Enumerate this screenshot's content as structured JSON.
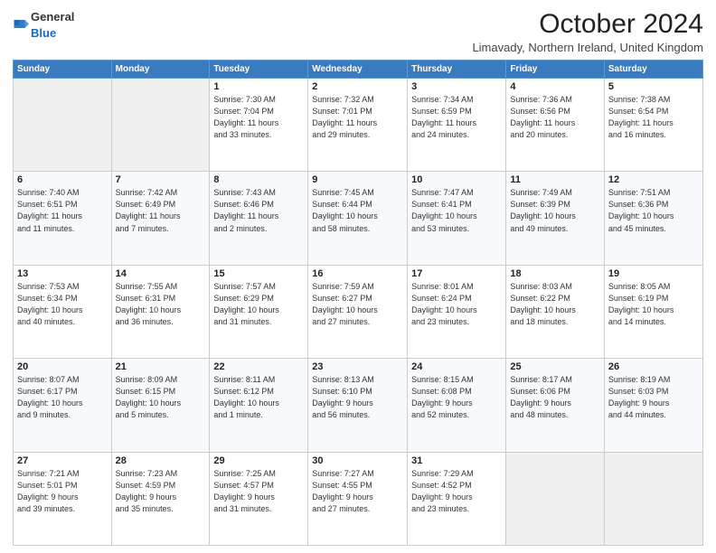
{
  "logo": {
    "general": "General",
    "blue": "Blue"
  },
  "header": {
    "month": "October 2024",
    "location": "Limavady, Northern Ireland, United Kingdom"
  },
  "weekdays": [
    "Sunday",
    "Monday",
    "Tuesday",
    "Wednesday",
    "Thursday",
    "Friday",
    "Saturday"
  ],
  "weeks": [
    [
      {
        "day": "",
        "info": ""
      },
      {
        "day": "",
        "info": ""
      },
      {
        "day": "1",
        "info": "Sunrise: 7:30 AM\nSunset: 7:04 PM\nDaylight: 11 hours\nand 33 minutes."
      },
      {
        "day": "2",
        "info": "Sunrise: 7:32 AM\nSunset: 7:01 PM\nDaylight: 11 hours\nand 29 minutes."
      },
      {
        "day": "3",
        "info": "Sunrise: 7:34 AM\nSunset: 6:59 PM\nDaylight: 11 hours\nand 24 minutes."
      },
      {
        "day": "4",
        "info": "Sunrise: 7:36 AM\nSunset: 6:56 PM\nDaylight: 11 hours\nand 20 minutes."
      },
      {
        "day": "5",
        "info": "Sunrise: 7:38 AM\nSunset: 6:54 PM\nDaylight: 11 hours\nand 16 minutes."
      }
    ],
    [
      {
        "day": "6",
        "info": "Sunrise: 7:40 AM\nSunset: 6:51 PM\nDaylight: 11 hours\nand 11 minutes."
      },
      {
        "day": "7",
        "info": "Sunrise: 7:42 AM\nSunset: 6:49 PM\nDaylight: 11 hours\nand 7 minutes."
      },
      {
        "day": "8",
        "info": "Sunrise: 7:43 AM\nSunset: 6:46 PM\nDaylight: 11 hours\nand 2 minutes."
      },
      {
        "day": "9",
        "info": "Sunrise: 7:45 AM\nSunset: 6:44 PM\nDaylight: 10 hours\nand 58 minutes."
      },
      {
        "day": "10",
        "info": "Sunrise: 7:47 AM\nSunset: 6:41 PM\nDaylight: 10 hours\nand 53 minutes."
      },
      {
        "day": "11",
        "info": "Sunrise: 7:49 AM\nSunset: 6:39 PM\nDaylight: 10 hours\nand 49 minutes."
      },
      {
        "day": "12",
        "info": "Sunrise: 7:51 AM\nSunset: 6:36 PM\nDaylight: 10 hours\nand 45 minutes."
      }
    ],
    [
      {
        "day": "13",
        "info": "Sunrise: 7:53 AM\nSunset: 6:34 PM\nDaylight: 10 hours\nand 40 minutes."
      },
      {
        "day": "14",
        "info": "Sunrise: 7:55 AM\nSunset: 6:31 PM\nDaylight: 10 hours\nand 36 minutes."
      },
      {
        "day": "15",
        "info": "Sunrise: 7:57 AM\nSunset: 6:29 PM\nDaylight: 10 hours\nand 31 minutes."
      },
      {
        "day": "16",
        "info": "Sunrise: 7:59 AM\nSunset: 6:27 PM\nDaylight: 10 hours\nand 27 minutes."
      },
      {
        "day": "17",
        "info": "Sunrise: 8:01 AM\nSunset: 6:24 PM\nDaylight: 10 hours\nand 23 minutes."
      },
      {
        "day": "18",
        "info": "Sunrise: 8:03 AM\nSunset: 6:22 PM\nDaylight: 10 hours\nand 18 minutes."
      },
      {
        "day": "19",
        "info": "Sunrise: 8:05 AM\nSunset: 6:19 PM\nDaylight: 10 hours\nand 14 minutes."
      }
    ],
    [
      {
        "day": "20",
        "info": "Sunrise: 8:07 AM\nSunset: 6:17 PM\nDaylight: 10 hours\nand 9 minutes."
      },
      {
        "day": "21",
        "info": "Sunrise: 8:09 AM\nSunset: 6:15 PM\nDaylight: 10 hours\nand 5 minutes."
      },
      {
        "day": "22",
        "info": "Sunrise: 8:11 AM\nSunset: 6:12 PM\nDaylight: 10 hours\nand 1 minute."
      },
      {
        "day": "23",
        "info": "Sunrise: 8:13 AM\nSunset: 6:10 PM\nDaylight: 9 hours\nand 56 minutes."
      },
      {
        "day": "24",
        "info": "Sunrise: 8:15 AM\nSunset: 6:08 PM\nDaylight: 9 hours\nand 52 minutes."
      },
      {
        "day": "25",
        "info": "Sunrise: 8:17 AM\nSunset: 6:06 PM\nDaylight: 9 hours\nand 48 minutes."
      },
      {
        "day": "26",
        "info": "Sunrise: 8:19 AM\nSunset: 6:03 PM\nDaylight: 9 hours\nand 44 minutes."
      }
    ],
    [
      {
        "day": "27",
        "info": "Sunrise: 7:21 AM\nSunset: 5:01 PM\nDaylight: 9 hours\nand 39 minutes."
      },
      {
        "day": "28",
        "info": "Sunrise: 7:23 AM\nSunset: 4:59 PM\nDaylight: 9 hours\nand 35 minutes."
      },
      {
        "day": "29",
        "info": "Sunrise: 7:25 AM\nSunset: 4:57 PM\nDaylight: 9 hours\nand 31 minutes."
      },
      {
        "day": "30",
        "info": "Sunrise: 7:27 AM\nSunset: 4:55 PM\nDaylight: 9 hours\nand 27 minutes."
      },
      {
        "day": "31",
        "info": "Sunrise: 7:29 AM\nSunset: 4:52 PM\nDaylight: 9 hours\nand 23 minutes."
      },
      {
        "day": "",
        "info": ""
      },
      {
        "day": "",
        "info": ""
      }
    ]
  ]
}
